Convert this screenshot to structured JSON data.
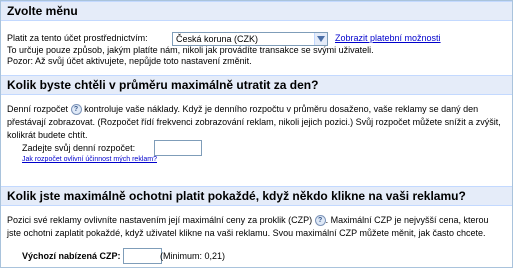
{
  "menu": {
    "title": "Zvolte měnu",
    "pay_label": "Platit za tento účet prostřednictvím:",
    "currency_selected": "Česká koruna (CZK)",
    "show_payment_link": "Zobrazit platební možnosti",
    "note1": "To určuje pouze způsob, jakým platíte nám, nikoli jak provádíte transakce se svými uživateli.",
    "note2": "Pozor: Až svůj účet aktivujete, nepůjde toto nastavení změnit."
  },
  "budget": {
    "title": "Kolik byste chtěli v průměru maximálně utratit za den?",
    "para_a": "Denní rozpočet",
    "para_b": "kontroluje vaše náklady. Když je denního rozpočtu v průměru dosaženo, vaše reklamy se daný den přestávají zobrazovat. (Rozpočet řídí frekvenci zobrazování reklam, nikoli jejich pozici.) Svůj rozpočet můžete snížit a zvýšit, kolikrát budete chtít.",
    "input_label": "Zadejte svůj denní rozpočet:",
    "input_value": "",
    "effect_link": "Jak rozpočet ovlivní účinnost mých reklam?"
  },
  "cpc": {
    "title": "Kolik jste maximálně ochotni platit pokaždé, když někdo klikne na vaši reklamu?",
    "para_a": "Pozici své reklamy ovlivníte nastavením její maximální ceny za proklik (CZP)",
    "para_b": ". Maximální CZP je nejvyšší cena, kterou jste ochotni zaplatit pokaždé, když uživatel klikne na vaši reklamu. Svou maximální CZP můžete měnit, jak často chcete.",
    "default_label": "Výchozí nabízená CZP:",
    "input_value": "",
    "minimum": "(Minimum: 0,21)"
  },
  "icons": {
    "help": "help-icon",
    "dropdown": "chevron-down-icon"
  },
  "colors": {
    "section_bg": "#e5ecf9",
    "section_border": "#c3d9ff",
    "link": "#0000cc"
  }
}
